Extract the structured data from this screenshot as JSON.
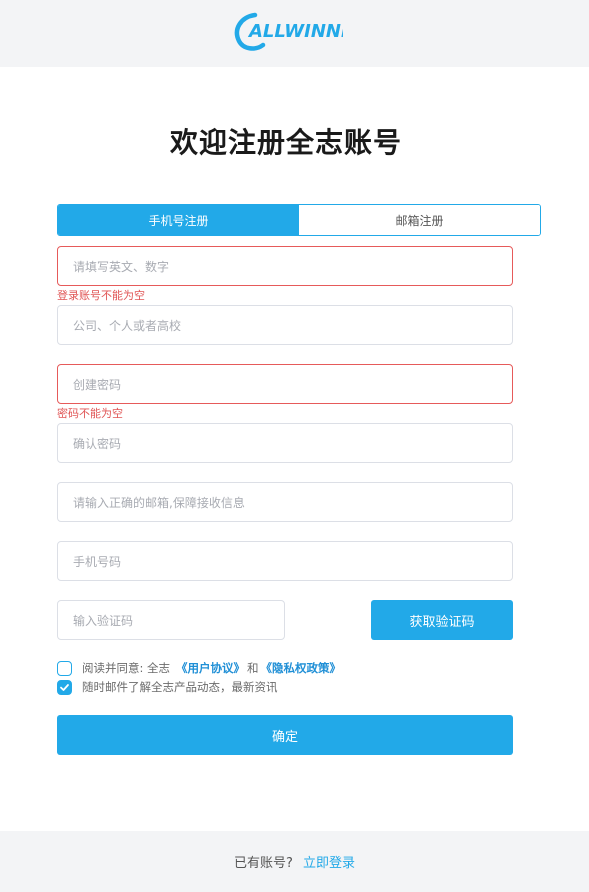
{
  "brand": {
    "logo_text": "ALLWINNER",
    "accent": "#22a9e8"
  },
  "page": {
    "title": "欢迎注册全志账号"
  },
  "tabs": [
    {
      "label": "手机号注册",
      "active": true
    },
    {
      "label": "邮箱注册",
      "active": false
    }
  ],
  "form": {
    "account": {
      "placeholder": "请填写英文、数字",
      "error": "登录账号不能为空"
    },
    "organization": {
      "placeholder": "公司、个人或者高校"
    },
    "password": {
      "placeholder": "创建密码",
      "error": "密码不能为空"
    },
    "confirm_password": {
      "placeholder": "确认密码"
    },
    "email": {
      "placeholder": "请输入正确的邮箱,保障接收信息"
    },
    "phone": {
      "placeholder": "手机号码"
    },
    "code": {
      "placeholder": "输入验证码"
    },
    "get_code_label": "获取验证码"
  },
  "agreement": {
    "prefix": "阅读并同意: 全志",
    "user_agreement": "《用户协议》",
    "and": "和",
    "privacy_policy": "《隐私权政策》",
    "checked": false
  },
  "subscribe": {
    "label": "随时邮件了解全志产品动态，最新资讯",
    "checked": true
  },
  "submit_label": "确定",
  "footer": {
    "text": "已有账号?",
    "login_link": "立即登录"
  }
}
